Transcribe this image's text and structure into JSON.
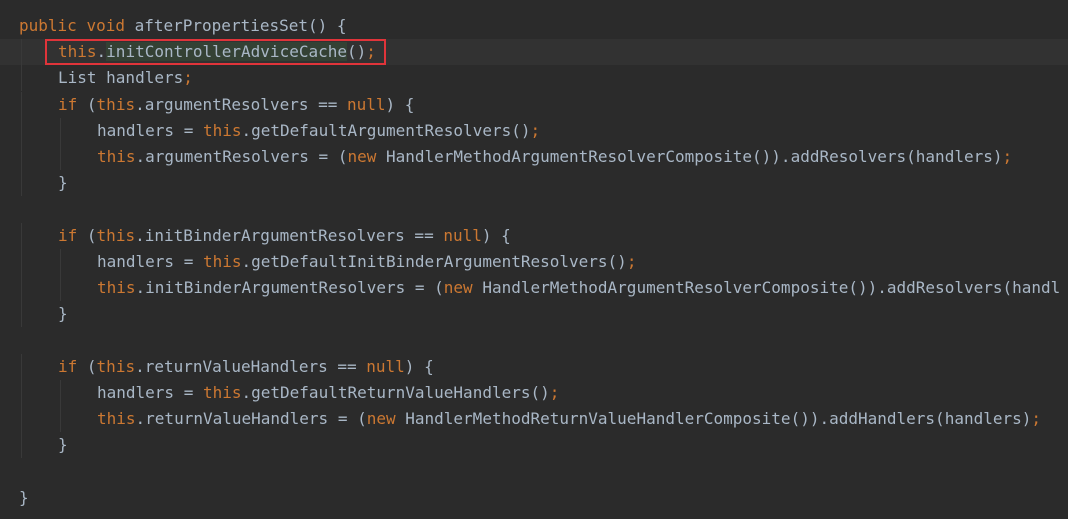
{
  "editor": {
    "lines": [
      {
        "tokens": [
          {
            "t": "public ",
            "k": "kw"
          },
          {
            "t": "void ",
            "k": "kw"
          },
          {
            "t": "afterPropertiesSet() {",
            "k": "id"
          }
        ]
      },
      {
        "tokens": [
          {
            "t": "this",
            "k": "kw"
          },
          {
            "t": ".",
            "k": "id"
          },
          {
            "t": "initControllerAdviceCache",
            "k": "id"
          },
          {
            "t": "()",
            "k": "id"
          },
          {
            "t": ";",
            "k": "semi"
          }
        ]
      },
      {
        "tokens": [
          {
            "t": "List handlers",
            "k": "id"
          },
          {
            "t": ";",
            "k": "semi"
          }
        ]
      },
      {
        "tokens": [
          {
            "t": "if ",
            "k": "kw"
          },
          {
            "t": "(",
            "k": "id"
          },
          {
            "t": "this",
            "k": "kw"
          },
          {
            "t": ".argumentResolvers == ",
            "k": "id"
          },
          {
            "t": "null",
            "k": "kw"
          },
          {
            "t": ") {",
            "k": "id"
          }
        ]
      },
      {
        "tokens": [
          {
            "t": "handlers = ",
            "k": "id"
          },
          {
            "t": "this",
            "k": "kw"
          },
          {
            "t": ".getDefaultArgumentResolvers()",
            "k": "id"
          },
          {
            "t": ";",
            "k": "semi"
          }
        ]
      },
      {
        "tokens": [
          {
            "t": "this",
            "k": "kw"
          },
          {
            "t": ".argumentResolvers = (",
            "k": "id"
          },
          {
            "t": "new ",
            "k": "kw"
          },
          {
            "t": "HandlerMethodArgumentResolverComposite()).addResolvers(handlers)",
            "k": "id"
          },
          {
            "t": ";",
            "k": "semi"
          }
        ]
      },
      {
        "tokens": [
          {
            "t": "}",
            "k": "id"
          }
        ]
      },
      {
        "tokens": []
      },
      {
        "tokens": [
          {
            "t": "if ",
            "k": "kw"
          },
          {
            "t": "(",
            "k": "id"
          },
          {
            "t": "this",
            "k": "kw"
          },
          {
            "t": ".initBinderArgumentResolvers == ",
            "k": "id"
          },
          {
            "t": "null",
            "k": "kw"
          },
          {
            "t": ") {",
            "k": "id"
          }
        ]
      },
      {
        "tokens": [
          {
            "t": "handlers = ",
            "k": "id"
          },
          {
            "t": "this",
            "k": "kw"
          },
          {
            "t": ".getDefaultInitBinderArgumentResolvers()",
            "k": "id"
          },
          {
            "t": ";",
            "k": "semi"
          }
        ]
      },
      {
        "tokens": [
          {
            "t": "this",
            "k": "kw"
          },
          {
            "t": ".initBinderArgumentResolvers = (",
            "k": "id"
          },
          {
            "t": "new ",
            "k": "kw"
          },
          {
            "t": "HandlerMethodArgumentResolverComposite()).addResolvers(handl",
            "k": "id"
          }
        ]
      },
      {
        "tokens": [
          {
            "t": "}",
            "k": "id"
          }
        ]
      },
      {
        "tokens": []
      },
      {
        "tokens": [
          {
            "t": "if ",
            "k": "kw"
          },
          {
            "t": "(",
            "k": "id"
          },
          {
            "t": "this",
            "k": "kw"
          },
          {
            "t": ".returnValueHandlers == ",
            "k": "id"
          },
          {
            "t": "null",
            "k": "kw"
          },
          {
            "t": ") {",
            "k": "id"
          }
        ]
      },
      {
        "tokens": [
          {
            "t": "handlers = ",
            "k": "id"
          },
          {
            "t": "this",
            "k": "kw"
          },
          {
            "t": ".getDefaultReturnValueHandlers()",
            "k": "id"
          },
          {
            "t": ";",
            "k": "semi"
          }
        ]
      },
      {
        "tokens": [
          {
            "t": "this",
            "k": "kw"
          },
          {
            "t": ".returnValueHandlers = (",
            "k": "id"
          },
          {
            "t": "new ",
            "k": "kw"
          },
          {
            "t": "HandlerMethodReturnValueHandlerComposite()).addHandlers(handlers)",
            "k": "id"
          },
          {
            "t": ";",
            "k": "semi"
          }
        ]
      },
      {
        "tokens": [
          {
            "t": "}",
            "k": "id"
          }
        ]
      },
      {
        "tokens": []
      },
      {
        "tokens": [
          {
            "t": "}",
            "k": "id"
          }
        ]
      }
    ],
    "highlighted_line": 1,
    "colors": {
      "background": "#2b2b2b",
      "identifier": "#a9b7c6",
      "keyword": "#cc7832",
      "current_line": "#323232",
      "highlight_border": "#e0343a"
    }
  }
}
